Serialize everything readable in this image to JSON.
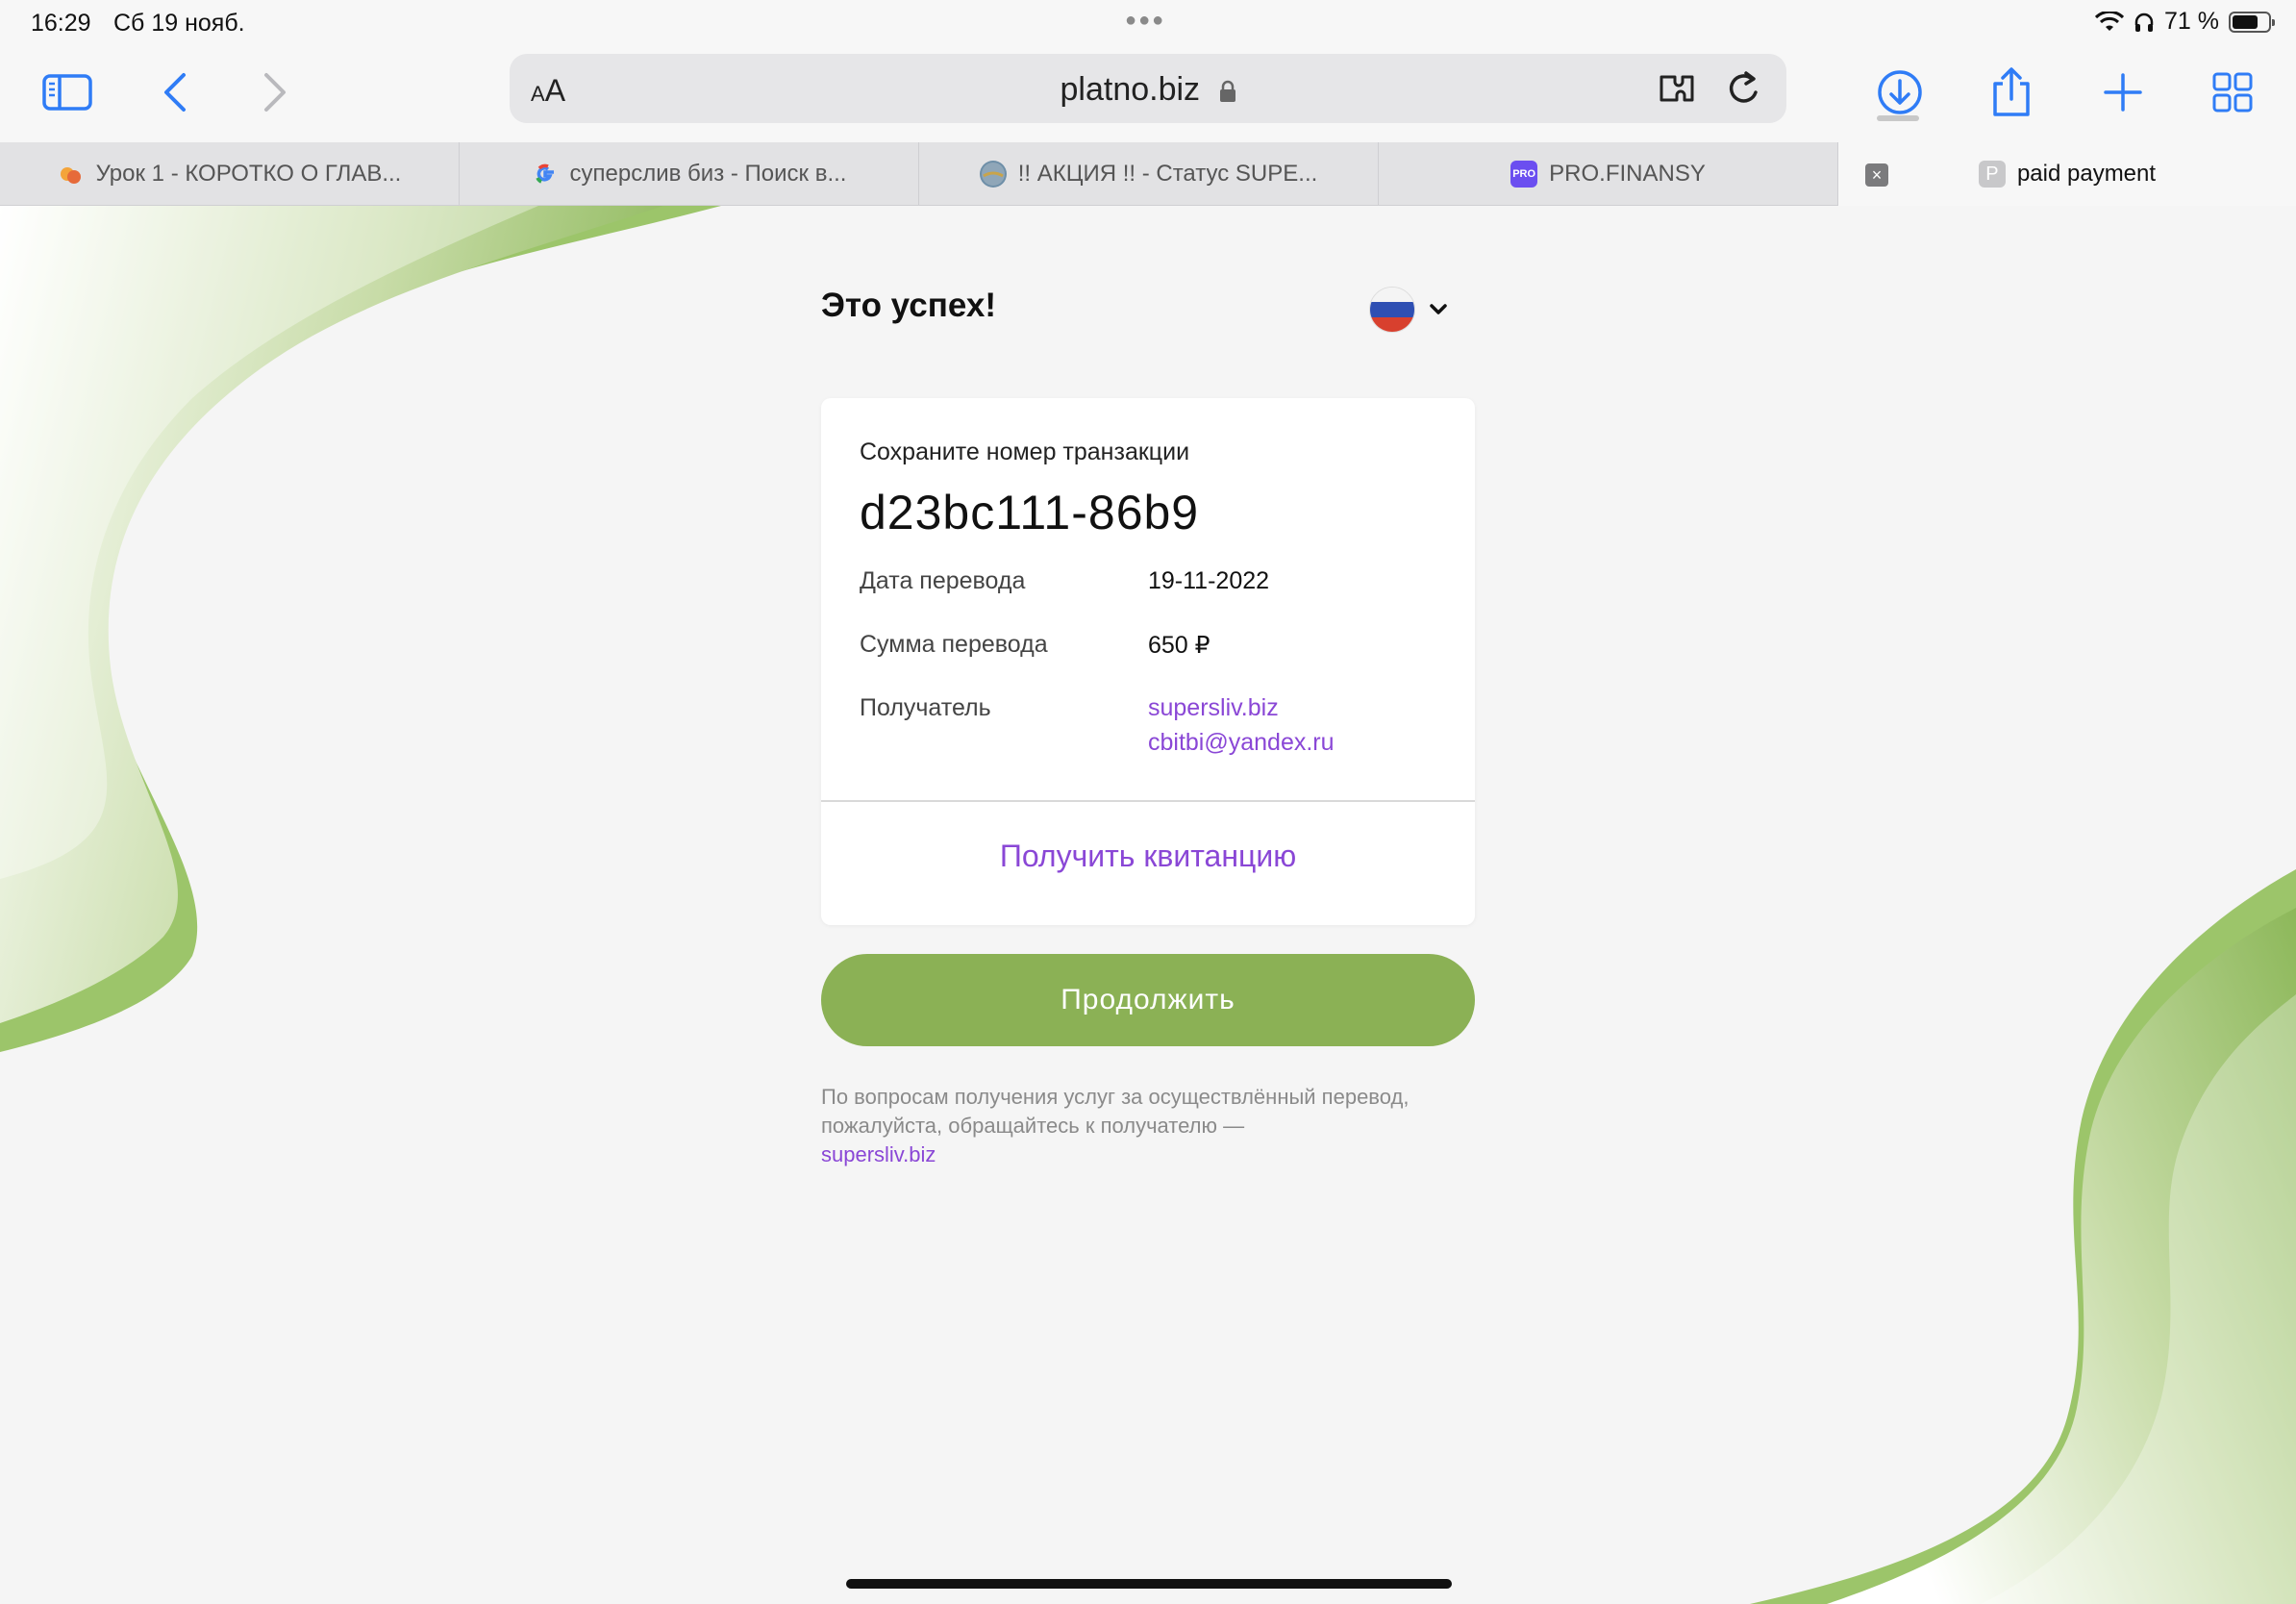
{
  "status_bar": {
    "time": "16:29",
    "date": "Сб 19 нояб.",
    "battery": "71 %",
    "battery_level": 0.71
  },
  "toolbar": {
    "text_size_label_small": "A",
    "text_size_label_large": "A",
    "url": "platno.biz"
  },
  "tabs": [
    {
      "title": "Урок 1 - КОРОТКО О ГЛАВ..."
    },
    {
      "title": "суперслив биз - Поиск в..."
    },
    {
      "title": "!! АКЦИЯ !! - Статус SUPE..."
    },
    {
      "title": "PRO.FINANSY",
      "favicon": "PRO"
    },
    {
      "title": "paid payment",
      "favicon": "P",
      "active": true
    }
  ],
  "page": {
    "heading": "Это успех!",
    "card": {
      "save_label": "Сохраните номер транзакции",
      "transaction_id": "d23bc111-86b9",
      "date_label": "Дата перевода",
      "date_value": "19-11-2022",
      "amount_label": "Сумма перевода",
      "amount_value": "650 ₽",
      "recipient_label": "Получатель",
      "recipient_site": "supersliv.biz",
      "recipient_email": "cbitbi@yandex.ru",
      "receipt_label": "Получить квитанцию"
    },
    "continue_label": "Продолжить",
    "note_text": "По вопросам получения услуг за осуществлённый перевод, пожалуйста, обращайтесь к получателю —",
    "note_link": "supersliv.biz"
  },
  "colors": {
    "accent_green": "#8bb155",
    "link_purple": "#8a47d6",
    "browser_blue": "#2f7cf6"
  }
}
